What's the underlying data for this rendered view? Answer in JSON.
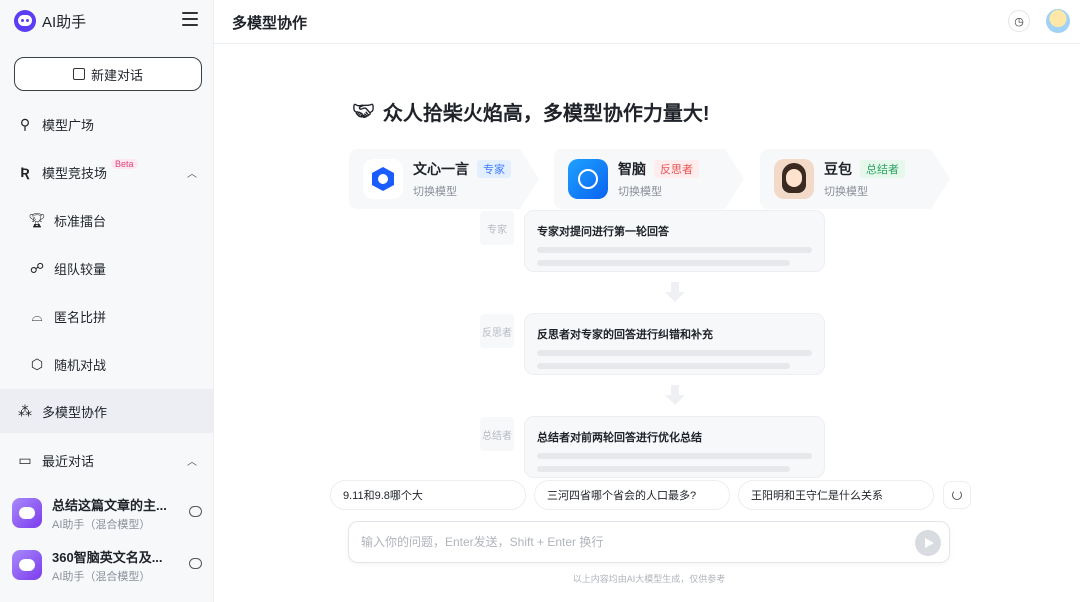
{
  "brand": {
    "name": "AI助手"
  },
  "sidebar": {
    "new_chat_label": "新建对话",
    "items": [
      {
        "label": "模型广场"
      },
      {
        "label": "模型竞技场",
        "badge": "Beta"
      },
      {
        "label": "标准擂台"
      },
      {
        "label": "组队较量"
      },
      {
        "label": "匿名比拼"
      },
      {
        "label": "随机对战"
      },
      {
        "label": "多模型协作"
      },
      {
        "label": "最近对话"
      }
    ],
    "recent": [
      {
        "title": "总结这篇文章的主...",
        "subtitle": "AI助手（混合模型）"
      },
      {
        "title": "360智脑英文名及...",
        "subtitle": "AI助手（混合模型）"
      }
    ]
  },
  "header": {
    "title": "多模型协作"
  },
  "main": {
    "headline": "众人拾柴火焰高，多模型协作力量大!",
    "models": [
      {
        "name": "文心一言",
        "role": "专家",
        "switch": "切换模型"
      },
      {
        "name": "智脑",
        "role": "反思者",
        "switch": "切换模型"
      },
      {
        "name": "豆包",
        "role": "总结者",
        "switch": "切换模型"
      }
    ],
    "flow": [
      {
        "role": "专家",
        "title": "专家对提问进行第一轮回答"
      },
      {
        "role": "反思者",
        "title": "反思者对专家的回答进行纠错和补充"
      },
      {
        "role": "总结者",
        "title": "总结者对前两轮回答进行优化总结"
      }
    ],
    "suggestions": [
      "9.11和9.8哪个大",
      "三河四省哪个省会的人口最多?",
      "王阳明和王守仁是什么关系"
    ],
    "input_placeholder": "输入你的问题，Enter发送，Shift + Enter 换行",
    "disclaimer": "以上内容均由AI大模型生成，仅供参考"
  },
  "colors": {
    "accent": "#5b3df5",
    "expert": "#3d7bff",
    "reflector": "#e65555",
    "summarizer": "#2ba360"
  }
}
